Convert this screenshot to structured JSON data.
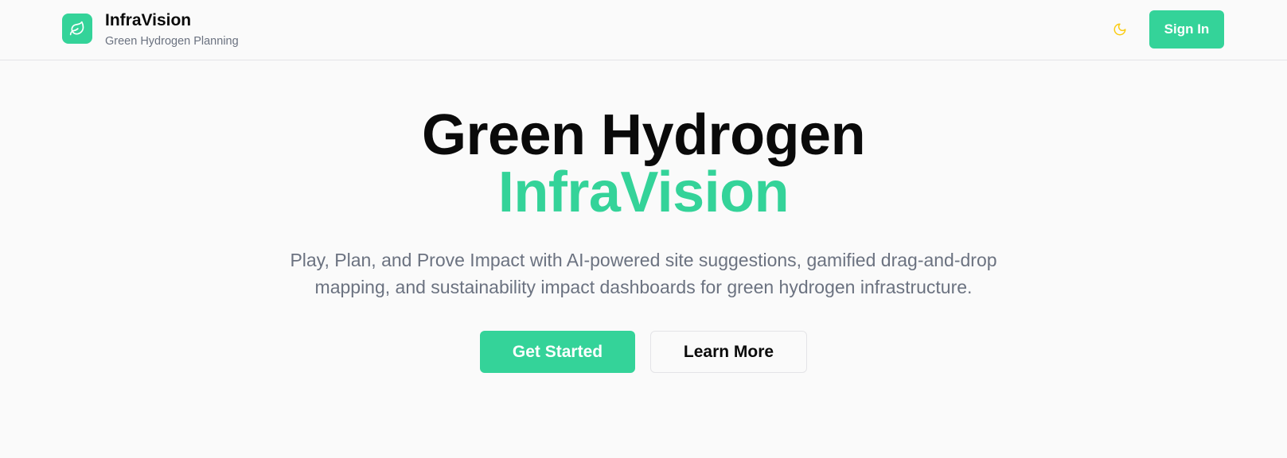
{
  "header": {
    "brand": {
      "title": "InfraVision",
      "subtitle": "Green Hydrogen Planning",
      "logo_icon": "leaf-icon"
    },
    "theme_toggle_icon": "moon-icon",
    "signin_label": "Sign In"
  },
  "hero": {
    "title_line_1": "Green Hydrogen",
    "title_line_2": "InfraVision",
    "description": "Play, Plan, and Prove Impact with AI-powered site suggestions, gamified drag-and-drop mapping, and sustainability impact dashboards for green hydrogen infrastructure.",
    "primary_cta": "Get Started",
    "secondary_cta": "Learn More"
  },
  "colors": {
    "accent": "#34d399",
    "moon_icon": "#facc15",
    "text": "#0a0a0a",
    "muted": "#6b7280",
    "background": "#fafafa"
  }
}
